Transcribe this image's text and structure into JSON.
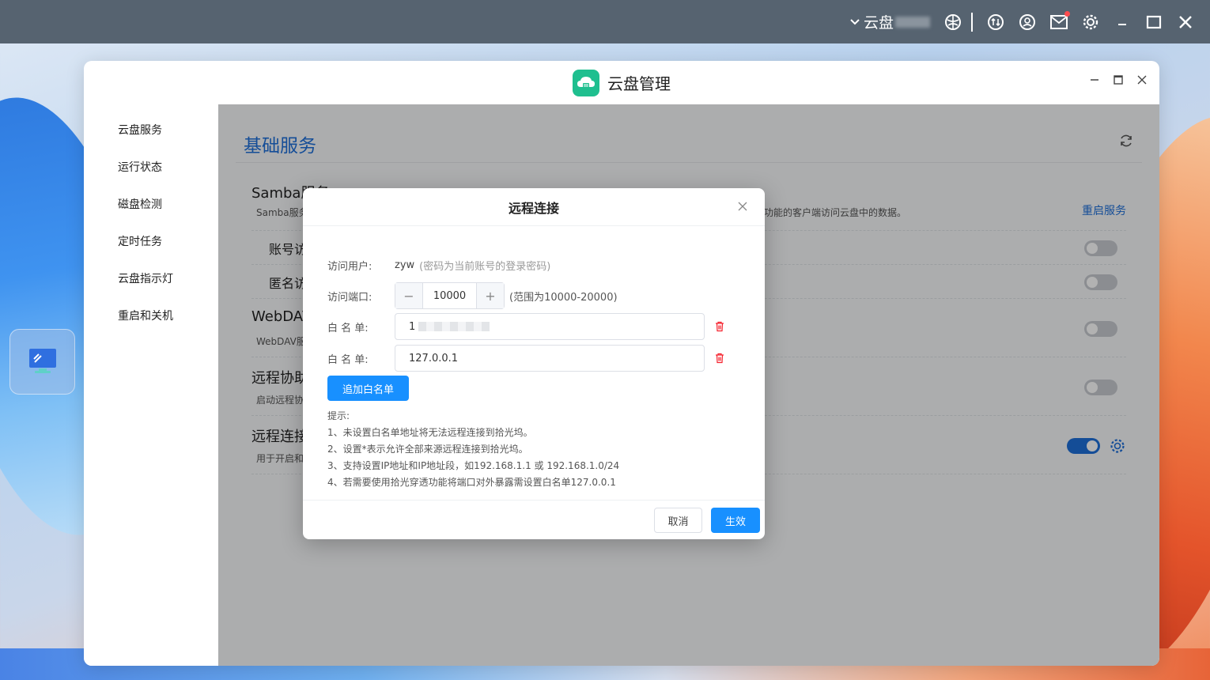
{
  "topbar": {
    "user_label": "云盘",
    "icons": [
      "chevron-down-icon",
      "network-icon",
      "arrows-icon",
      "user-circle-icon",
      "mail-icon",
      "gear-icon",
      "minimize-icon",
      "maximize-icon",
      "close-icon"
    ]
  },
  "window": {
    "title": "云盘管理"
  },
  "sidebar": {
    "items": [
      {
        "label": "云盘服务"
      },
      {
        "label": "运行状态"
      },
      {
        "label": "磁盘检测"
      },
      {
        "label": "定时任务"
      },
      {
        "label": "云盘指示灯"
      },
      {
        "label": "重启和关机"
      }
    ]
  },
  "content": {
    "page_title": "基础服务",
    "samba": {
      "title": "Samba服务",
      "desc_left": "Samba服务",
      "desc_right": "功能的客户端访问云盘中的数据。",
      "restart_link": "重启服务",
      "rows": [
        {
          "label": "账号访",
          "toggle": false
        },
        {
          "label": "匿名访",
          "toggle": false
        }
      ]
    },
    "webdav": {
      "title": "WebDAV",
      "desc": "WebDAV服",
      "toggle": false
    },
    "remote_assist": {
      "title": "远程协助",
      "desc": "启动远程协",
      "toggle": false
    },
    "remote_connect": {
      "title": "远程连接",
      "desc": "用于开启和",
      "toggle": true
    }
  },
  "modal": {
    "title": "远程连接",
    "user_label": "访问用户:",
    "user_value": "zyw",
    "user_hint": "(密码为当前账号的登录密码)",
    "port_label": "访问端口:",
    "port_value": "10000",
    "port_hint": "(范围为10000-20000)",
    "whitelist_label": "白 名 单:",
    "whitelist": [
      "1",
      "127.0.0.1"
    ],
    "add_button": "追加白名单",
    "tips_title": "提示:",
    "tips": [
      "1、未设置白名单地址将无法远程连接到拾光坞。",
      "2、设置*表示允许全部来源远程连接到拾光坞。",
      "3、支持设置IP地址和IP地址段，如192.168.1.1 或 192.168.1.0/24",
      "4、若需要使用拾光穿透功能将端口对外暴露需设置白名单127.0.0.1"
    ],
    "cancel": "取消",
    "confirm": "生效"
  },
  "colors": {
    "accent": "#1890ff",
    "title_blue": "#1e6fd9",
    "topbar": "#566370",
    "app_icon": "#1fbf8f",
    "danger": "#f5222d"
  }
}
